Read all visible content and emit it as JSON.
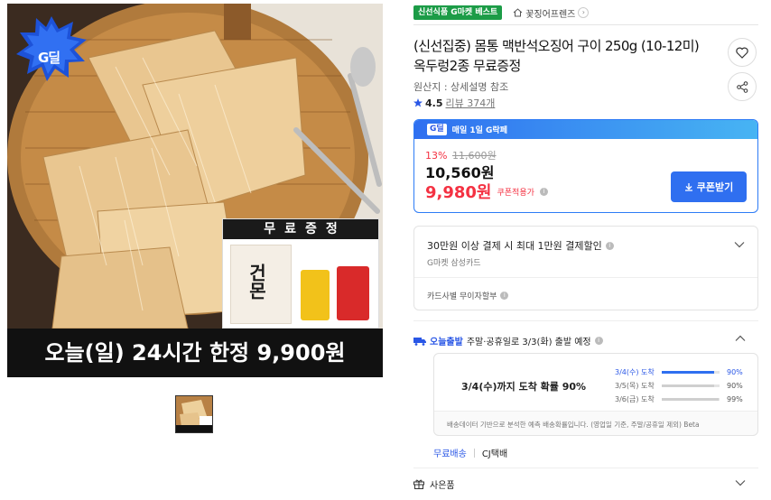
{
  "image": {
    "badge_text": "G딜",
    "gift_title": "무료증정",
    "gift_package_text": "건몬",
    "banner_text": "오늘(일) 24시간 한정 9,900원"
  },
  "tags": {
    "best": "신선식품 G마켓 베스트",
    "store": "꽃징어프렌즈"
  },
  "title": "(신선집중) 몸통 맥반석오징어 구이 250g (10-12미) 옥두렁2종 무료증정",
  "origin": "원산지 : 상세설명 참조",
  "rating": {
    "score": "4.5",
    "review": "리뷰 374개"
  },
  "price": {
    "header_badge": "G딜",
    "header_text": "매일 1일 G락페",
    "discount": "13%",
    "original": "11,600원",
    "sale": "10,560원",
    "coupon_price": "9,980원",
    "coupon_label": "쿠폰적용가",
    "coupon_button": "쿠폰받기"
  },
  "card": {
    "title": "30만원 이상 결제 시 최대 1만원 결제할인",
    "subtitle": "G마켓 삼성카드",
    "installment": "카드사별 무이자할부"
  },
  "shipping": {
    "today": "오늘출발",
    "desc": "주말·공휴일로 3/3(화) 출발 예정",
    "probability_text": "3/4(수)까지 도착 확률 90%",
    "rows": [
      {
        "date": "3/4(수) 도착",
        "pct": "90%",
        "value": 90
      },
      {
        "date": "3/5(목) 도착",
        "pct": "90%",
        "value": 90
      },
      {
        "date": "3/6(금) 도착",
        "pct": "99%",
        "value": 99
      }
    ],
    "note": "배송데이터 기반으로 분석한 예측 배송확률입니다. (영업일 기준, 주말/공휴일 제외) Beta",
    "free": "무료배송",
    "courier": "CJ택배"
  },
  "gift": {
    "label": "사은품"
  },
  "colors": {
    "accent_blue": "#2f6ff0",
    "sale_red": "#f43142",
    "best_green": "#1c9c47"
  }
}
